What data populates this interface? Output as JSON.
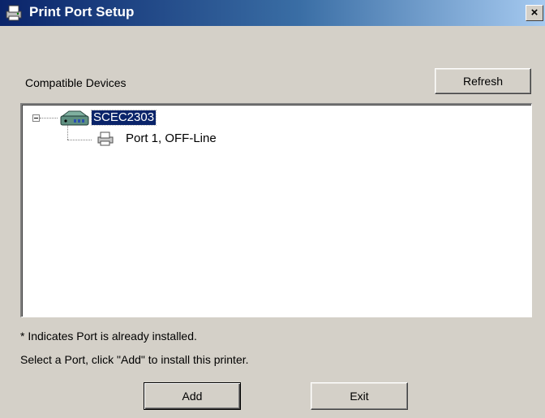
{
  "window": {
    "title": "Print Port Setup",
    "close_label": "×"
  },
  "compatible_devices_label": "Compatible Devices",
  "refresh_label": "Refresh",
  "tree": {
    "device": {
      "label": "SCEC2303",
      "icon": "network-device-icon",
      "expanded": true,
      "selected": true
    },
    "port": {
      "label": "Port 1, OFF-Line",
      "icon": "printer-icon"
    }
  },
  "note_installed": "* Indicates Port is already installed.",
  "instruction": "Select a Port, click \"Add\" to install this printer.",
  "buttons": {
    "add_label": "Add",
    "exit_label": "Exit"
  },
  "colors": {
    "title_bar": "#0a246a",
    "selection": "#0a246a",
    "dialog_bg": "#d4d0c8"
  }
}
